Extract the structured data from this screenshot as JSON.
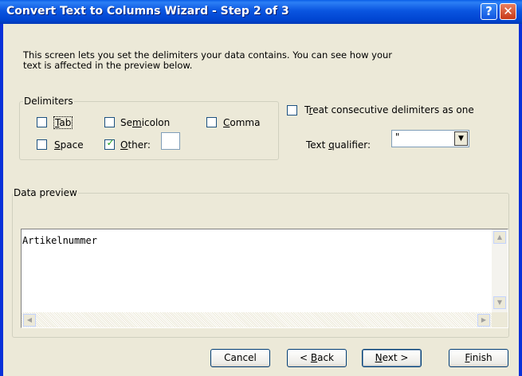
{
  "window": {
    "title": "Convert Text to Columns Wizard - Step 2 of 3",
    "help_glyph": "?",
    "close_glyph": "✕"
  },
  "intro": "This screen lets you set the delimiters your data contains.  You can see how your text is affected in the preview below.",
  "delimiters": {
    "group_label": "Delimiters",
    "tab": {
      "label": "Tab",
      "mnemonic": "T",
      "checked": false
    },
    "semicolon": {
      "pre": "Se",
      "mnemonic": "m",
      "post": "icolon",
      "checked": false
    },
    "comma": {
      "pre": "",
      "mnemonic": "C",
      "post": "omma",
      "checked": false
    },
    "space": {
      "pre": "",
      "mnemonic": "S",
      "post": "pace",
      "checked": false
    },
    "other": {
      "pre": "",
      "mnemonic": "O",
      "post": "ther:",
      "checked": true,
      "value": ""
    }
  },
  "consecutive": {
    "pre": "",
    "mnemonic": "r",
    "label_full": "Treat consecutive delimiters as one",
    "checked": false
  },
  "qualifier": {
    "label": "Text qualifier:",
    "value": "\"",
    "check_glyph": "✓",
    "arrow_glyph": "▼"
  },
  "preview": {
    "group_label": "Data preview",
    "lines": [
      "Artikelnummer"
    ]
  },
  "buttons": {
    "cancel": "Cancel",
    "back": "< Back",
    "next": "Next >",
    "finish": "Finish"
  },
  "colors": {
    "titlebar": "#0a55e0",
    "dialog_bg": "#ece9d8",
    "check": "#21a121"
  }
}
